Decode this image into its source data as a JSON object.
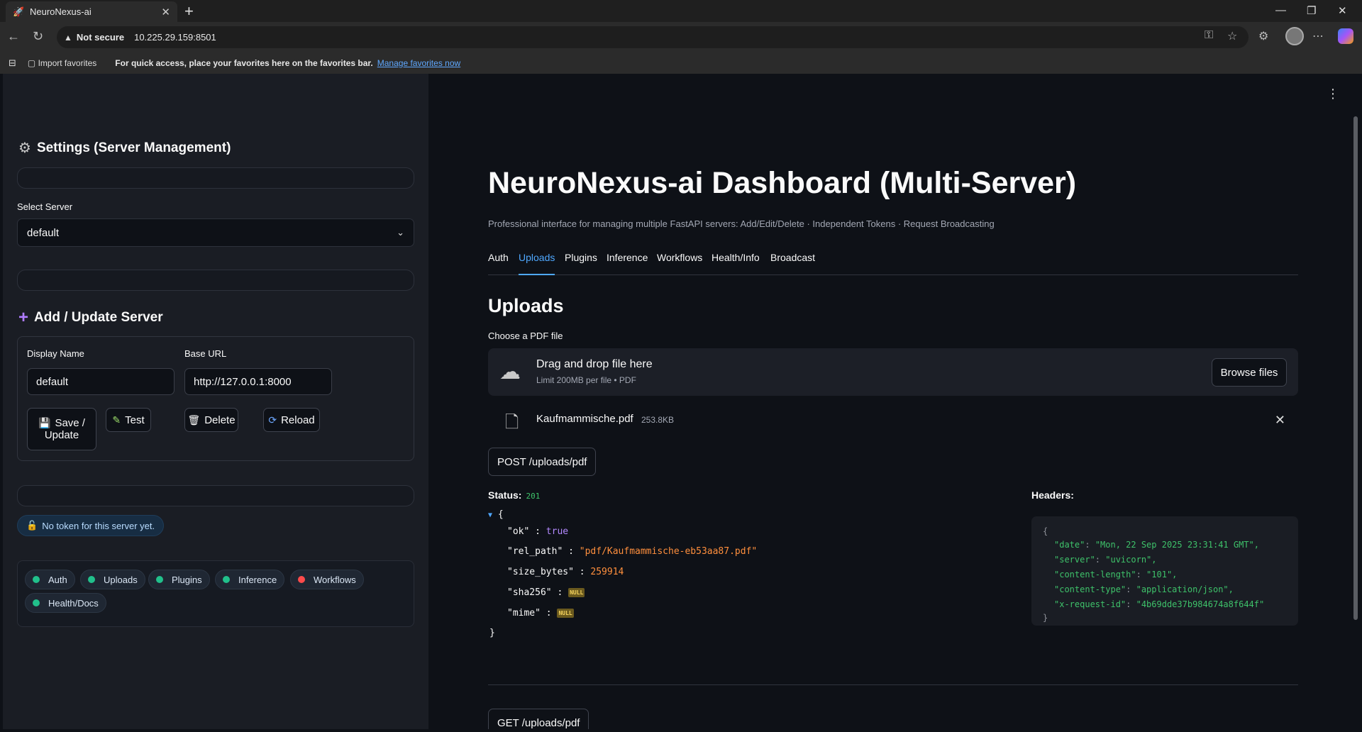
{
  "browser": {
    "tab_title": "NeuroNexus-ai",
    "not_secure": "Not secure",
    "url": "10.225.29.159:8501",
    "import_favorites": "Import favorites",
    "fav_message": "For quick access, place your favorites here on the favorites bar.",
    "fav_link": "Manage favorites now"
  },
  "sidebar": {
    "settings_title": "Settings (Server Management)",
    "select_label": "Select Server",
    "selected_server": "default",
    "add_title": "Add / Update Server",
    "display_name_label": "Display Name",
    "display_name_value": "default",
    "base_url_label": "Base URL",
    "base_url_value": "http://127.0.0.1:8000",
    "save_label_1": "Save /",
    "save_label_2": "Update",
    "test_label": "Test",
    "delete_label": "Delete",
    "reload_label": "Reload",
    "token_notice": "No token for this server yet.",
    "chips": [
      {
        "label": "Auth",
        "status_color": "#21c08b"
      },
      {
        "label": "Uploads",
        "status_color": "#21c08b"
      },
      {
        "label": "Plugins",
        "status_color": "#21c08b"
      },
      {
        "label": "Inference",
        "status_color": "#21c08b"
      },
      {
        "label": "Workflows",
        "status_color": "#ff4b4b"
      },
      {
        "label": "Health/Docs",
        "status_color": "#21c08b"
      }
    ]
  },
  "main": {
    "title": "NeuroNexus-ai Dashboard (Multi-Server)",
    "subtitle": "Professional interface for managing multiple FastAPI servers: Add/Edit/Delete · Independent Tokens · Request Broadcasting",
    "tabs": [
      "Auth",
      "Uploads",
      "Plugins",
      "Inference",
      "Workflows",
      "Health/Info",
      "Broadcast"
    ],
    "active_tab": "Uploads",
    "section_title": "Uploads",
    "choose_label": "Choose a PDF file",
    "dropzone_main": "Drag and drop file here",
    "dropzone_sub": "Limit 200MB per file • PDF",
    "browse_label": "Browse files",
    "file_name": "Kaufmammische.pdf",
    "file_size": "253.8KB",
    "post_button": "POST /uploads/pdf",
    "status_label": "Status:",
    "status_code": "201",
    "response": {
      "ok_key": "\"ok\"",
      "ok_val": "true",
      "rel_path_key": "\"rel_path\"",
      "rel_path_val": "\"pdf/Kaufmammische-eb53aa87.pdf\"",
      "size_key": "\"size_bytes\"",
      "size_val": "259914",
      "sha_key": "\"sha256\"",
      "mime_key": "\"mime\"",
      "null_text": "NULL"
    },
    "headers_label": "Headers:",
    "headers": [
      {
        "k": "\"date\"",
        "v": "\"Mon, 22 Sep 2025 23:31:41 GMT\","
      },
      {
        "k": "\"server\"",
        "v": "\"uvicorn\","
      },
      {
        "k": "\"content-length\"",
        "v": "\"101\","
      },
      {
        "k": "\"content-type\"",
        "v": "\"application/json\","
      },
      {
        "k": "\"x-request-id\"",
        "v": "\"4b69dde37b984674a8f644f\""
      }
    ],
    "get_button": "GET /uploads/pdf"
  }
}
